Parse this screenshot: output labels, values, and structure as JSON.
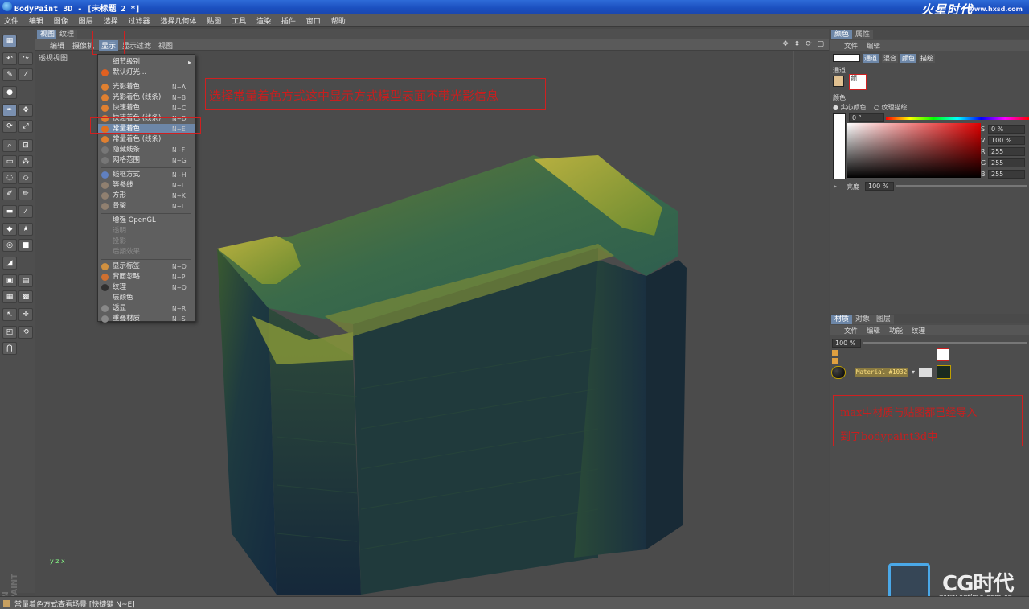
{
  "window": {
    "title": "BodyPaint 3D - [未标题 2 *]",
    "logo_text": "火星时代",
    "logo_url": "www.hxsd.com"
  },
  "menubar": [
    "文件",
    "编辑",
    "图像",
    "图层",
    "选择",
    "过滤器",
    "选择几何体",
    "贴图",
    "工具",
    "渲染",
    "插件",
    "窗口",
    "帮助"
  ],
  "viewport": {
    "tabs": [
      "视图",
      "纹理"
    ],
    "menu": [
      "编辑",
      "摄像机",
      "显示",
      "显示过滤",
      "视图"
    ],
    "active_menu": "显示",
    "view_label": "透视视图",
    "axis_label": "y z x",
    "nav_icons": "✥ ⬍ ⟳ ▢"
  },
  "dropdown": {
    "items": [
      {
        "label": "细节级别",
        "shortcut": "",
        "submenu": true,
        "disabled": false,
        "icon": ""
      },
      {
        "label": "默认灯光...",
        "shortcut": "",
        "submenu": false,
        "disabled": false,
        "icon": "#e06020"
      },
      {
        "label": "光影着色",
        "shortcut": "N~A",
        "submenu": false,
        "disabled": false,
        "icon": "#e08030"
      },
      {
        "label": "光影着色 (线条)",
        "shortcut": "N~B",
        "submenu": false,
        "disabled": false,
        "icon": "#e08030"
      },
      {
        "label": "快速着色",
        "shortcut": "N~C",
        "submenu": false,
        "disabled": false,
        "icon": "#e08030"
      },
      {
        "label": "快速着色 (线条)",
        "shortcut": "N~D",
        "submenu": false,
        "disabled": false,
        "icon": "#e08030"
      },
      {
        "label": "常量着色",
        "shortcut": "N~E",
        "submenu": false,
        "disabled": false,
        "icon": "#e07020",
        "selected": true
      },
      {
        "label": "常量着色 (线条)",
        "shortcut": "",
        "submenu": false,
        "disabled": false,
        "icon": "#e08030"
      },
      {
        "label": "隐藏线条",
        "shortcut": "N~F",
        "submenu": false,
        "disabled": false,
        "icon": "#777"
      },
      {
        "label": "网格范围",
        "shortcut": "N~G",
        "submenu": false,
        "disabled": false,
        "icon": "#777"
      },
      {
        "label": "线框方式",
        "shortcut": "N~H",
        "submenu": false,
        "disabled": false,
        "icon": "#6080c0"
      },
      {
        "label": "等参线",
        "shortcut": "N~I",
        "submenu": false,
        "disabled": false,
        "icon": "#908070"
      },
      {
        "label": "方形",
        "shortcut": "N~K",
        "submenu": false,
        "disabled": false,
        "icon": "#908070"
      },
      {
        "label": "骨架",
        "shortcut": "N~L",
        "submenu": false,
        "disabled": false,
        "icon": "#908070"
      },
      {
        "label": "增强 OpenGL",
        "shortcut": "",
        "submenu": false,
        "disabled": false,
        "icon": ""
      },
      {
        "label": "透明",
        "shortcut": "",
        "submenu": false,
        "disabled": true,
        "icon": ""
      },
      {
        "label": "投影",
        "shortcut": "",
        "submenu": false,
        "disabled": true,
        "icon": ""
      },
      {
        "label": "后期效果",
        "shortcut": "",
        "submenu": false,
        "disabled": true,
        "icon": ""
      },
      {
        "label": "显示标签",
        "shortcut": "N~O",
        "submenu": false,
        "disabled": false,
        "icon": "#d09040"
      },
      {
        "label": "背面忽略",
        "shortcut": "N~P",
        "submenu": false,
        "disabled": false,
        "icon": "#d07030"
      },
      {
        "label": "纹理",
        "shortcut": "N~Q",
        "submenu": false,
        "disabled": false,
        "icon": "#303030"
      },
      {
        "label": "层颜色",
        "shortcut": "",
        "submenu": false,
        "disabled": false,
        "icon": ""
      },
      {
        "label": "透显",
        "shortcut": "N~R",
        "submenu": false,
        "disabled": false,
        "icon": "#888"
      },
      {
        "label": "重叠材质",
        "shortcut": "N~S",
        "submenu": false,
        "disabled": false,
        "icon": "#888"
      }
    ]
  },
  "annotations": {
    "top": "选择常量着色方式这中显示方式模型表面不带光影信息",
    "bottom_line1": "max中材质与贴图都已经导入",
    "bottom_line2": "到了bodypaint3d中"
  },
  "color_panel": {
    "tabs": [
      "颜色",
      "属性"
    ],
    "menu": [
      "文件",
      "编辑"
    ],
    "mode_chips": [
      "通道",
      "混合",
      "颜色",
      "描绘"
    ],
    "channels_label": "通道",
    "channel_name": "颜",
    "color_label": "颜色",
    "radio_solid": "实心颜色",
    "radio_texture": "纹理描绘",
    "angle_value": "0 °",
    "hsv": [
      {
        "k": "S",
        "v": "0 %"
      },
      {
        "k": "V",
        "v": "100 %"
      },
      {
        "k": "R",
        "v": "255"
      },
      {
        "k": "G",
        "v": "255"
      },
      {
        "k": "B",
        "v": "255"
      }
    ],
    "brightness_label": "亮度",
    "brightness_value": "100 %"
  },
  "material_panel": {
    "tabs": [
      "材质",
      "对象",
      "图层"
    ],
    "menu": [
      "文件",
      "编辑",
      "功能",
      "纹理"
    ],
    "zoom": "100 %",
    "material_name": "Material #1032"
  },
  "statusbar": {
    "text": "常量着色方式查看场景 [快捷键 N~E]"
  },
  "watermark": {
    "maxon": "MAXON BODYPAINT 3D",
    "cg_text": "CG时代",
    "cg_url": "www.cgtime.com.cn"
  },
  "colors": {
    "highlight": "#6d87a8",
    "annotation_red": "#d02020",
    "titlebar_blue": "#1b4fbf"
  }
}
